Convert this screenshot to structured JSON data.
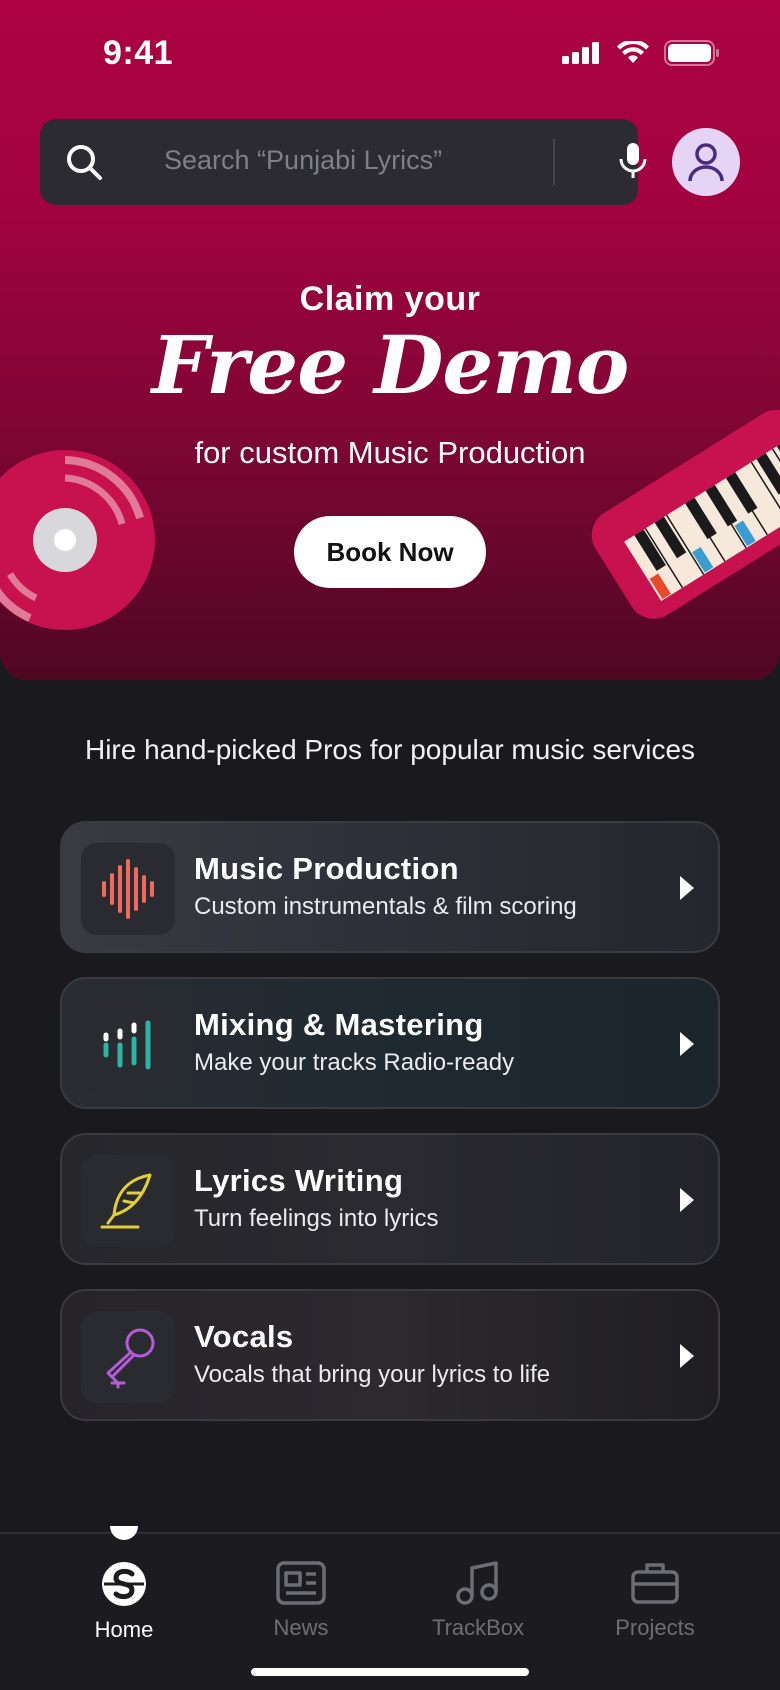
{
  "status": {
    "time": "9:41"
  },
  "search": {
    "placeholder": "Search “Punjabi Lyrics”"
  },
  "hero": {
    "claim": "Claim your",
    "headline": "Free Demo",
    "subline": "for custom Music Production",
    "cta": "Book Now",
    "accent": "#ad0343"
  },
  "services": {
    "heading": "Hire hand-picked Pros for popular music services",
    "items": [
      {
        "title": "Music Production",
        "desc": "Custom instrumentals & film scoring",
        "icon": "waveform-icon",
        "icon_color": "#f06a5e"
      },
      {
        "title": "Mixing & Mastering",
        "desc": "Make your tracks Radio-ready",
        "icon": "equalizer-icon",
        "icon_color": "#2ab3a6"
      },
      {
        "title": "Lyrics Writing",
        "desc": "Turn feelings into lyrics",
        "icon": "quill-icon",
        "icon_color": "#e2cf33"
      },
      {
        "title": "Vocals",
        "desc": "Vocals that bring your lyrics to life",
        "icon": "microphone-icon",
        "icon_color": "#b45bd8"
      }
    ]
  },
  "nav": {
    "items": [
      {
        "label": "Home",
        "icon": "home-logo-icon",
        "active": true
      },
      {
        "label": "News",
        "icon": "news-icon"
      },
      {
        "label": "TrackBox",
        "icon": "music-note-icon"
      },
      {
        "label": "Projects",
        "icon": "briefcase-icon"
      }
    ]
  }
}
